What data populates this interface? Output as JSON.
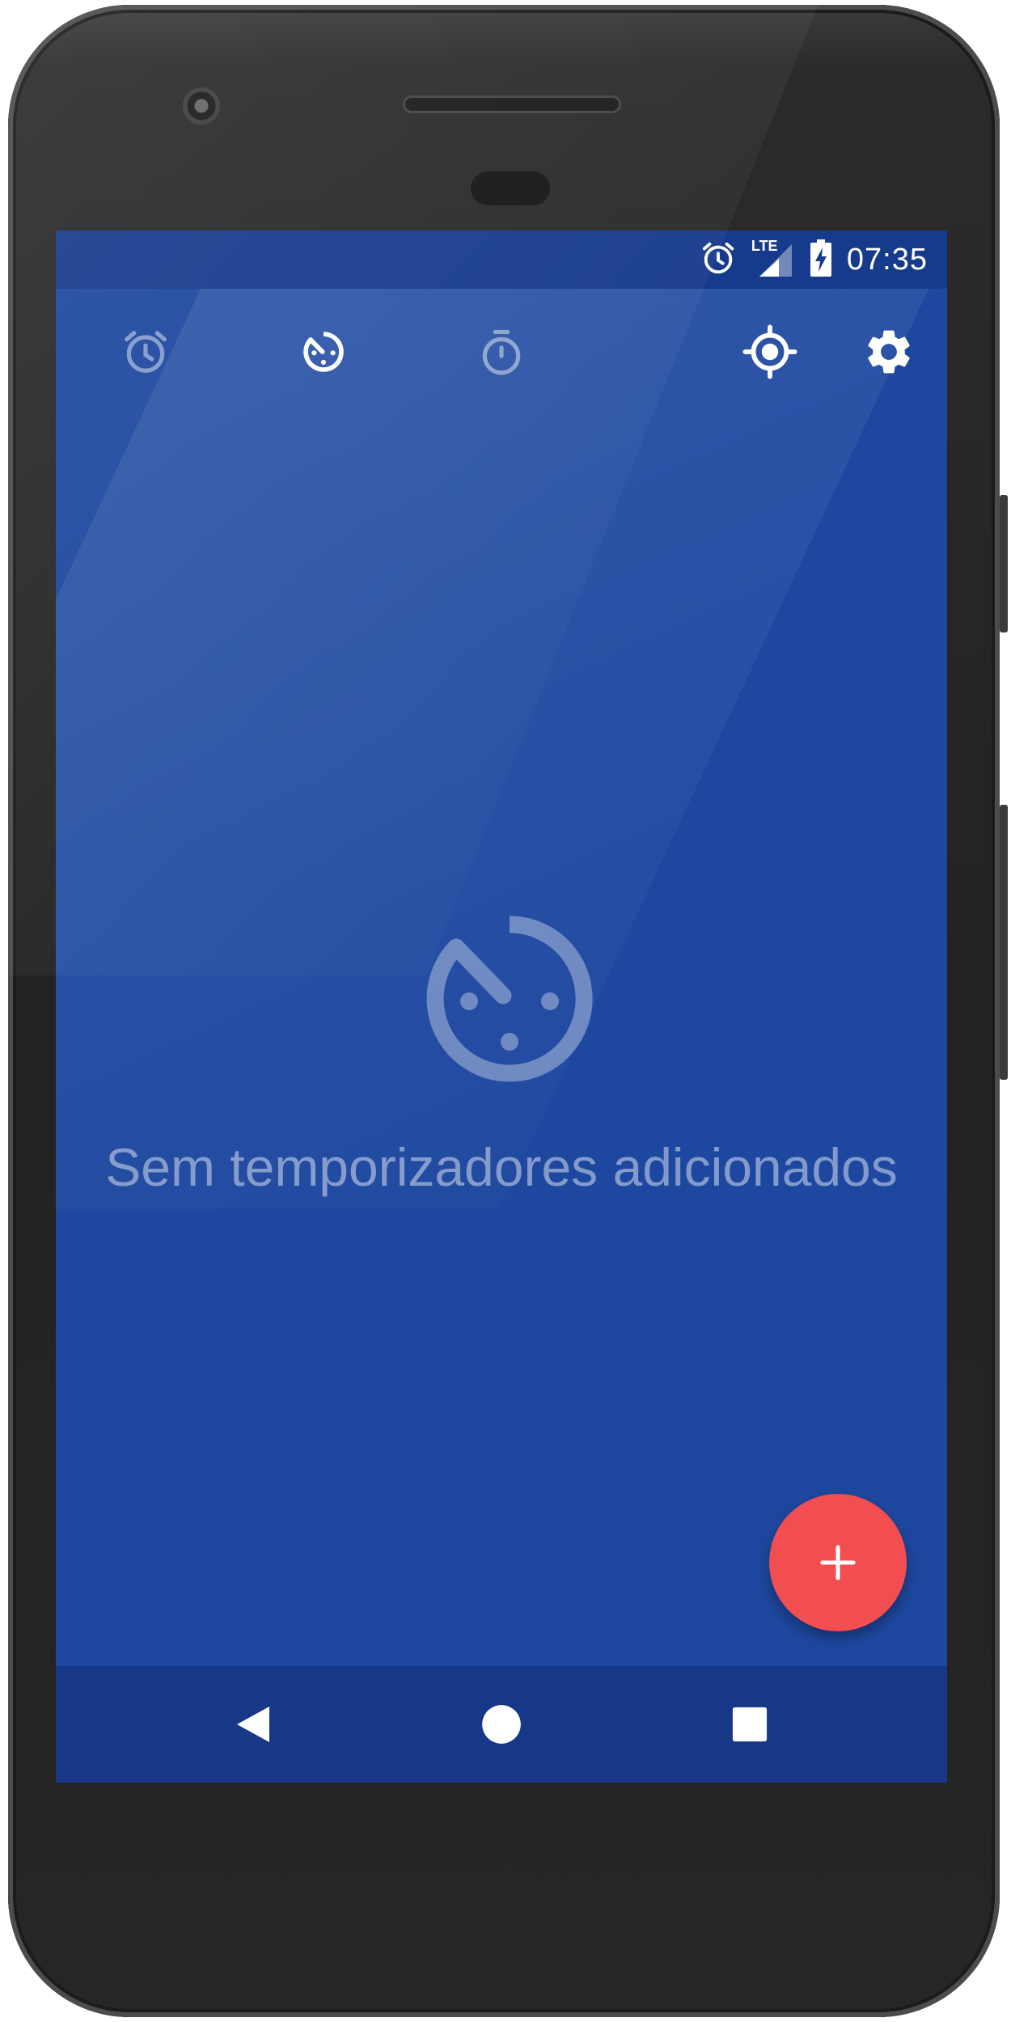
{
  "status_bar": {
    "time": "07:35",
    "network_label": "LTE",
    "icons": [
      "alarm-icon",
      "signal-icon",
      "battery-charging-icon"
    ]
  },
  "tabs": [
    {
      "name": "alarm",
      "icon": "alarm-clock-icon",
      "active": false
    },
    {
      "name": "timer",
      "icon": "timer-icon",
      "active": true
    },
    {
      "name": "stopwatch",
      "icon": "stopwatch-icon",
      "active": false
    }
  ],
  "actions": [
    {
      "name": "location",
      "icon": "gps-target-icon"
    },
    {
      "name": "settings",
      "icon": "gear-icon"
    }
  ],
  "empty_state": {
    "icon": "timer-icon",
    "message": "Sem temporizadores adicionados"
  },
  "fab": {
    "icon": "plus-icon"
  },
  "nav": [
    "back-icon",
    "home-icon",
    "recents-icon"
  ],
  "colors": {
    "screen_background": "#1e48a0",
    "status_bar": "#173b8c",
    "nav_bar": "#173787",
    "fab": "#f24d51"
  }
}
